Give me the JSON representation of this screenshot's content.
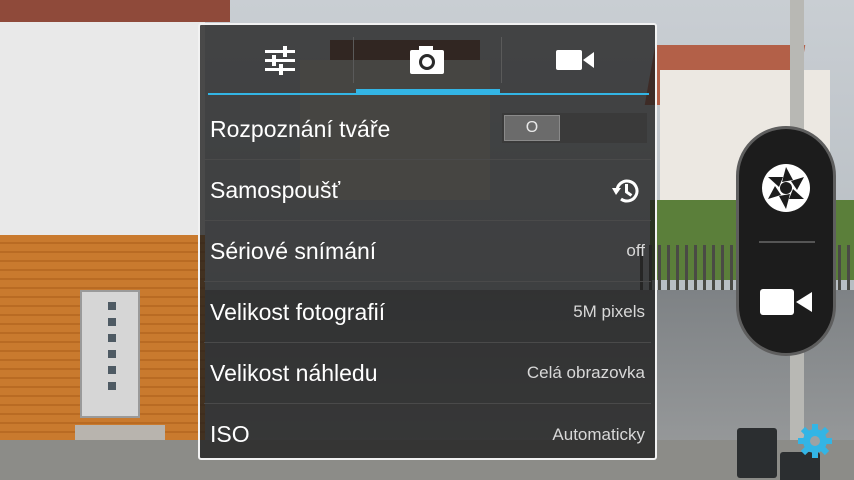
{
  "tabs": [
    {
      "icon": "settings-sliders-icon",
      "active": false
    },
    {
      "icon": "camera-icon",
      "active": true
    },
    {
      "icon": "video-camera-icon",
      "active": false
    }
  ],
  "settings": {
    "face_detection": {
      "label": "Rozpoznání tváře",
      "value": "O"
    },
    "self_timer": {
      "label": "Samospoušť",
      "icon": "timer-icon"
    },
    "burst": {
      "label": "Sériové snímání",
      "value": "off"
    },
    "photo_size": {
      "label": "Velikost fotografií",
      "value": "5M pixels"
    },
    "preview_size": {
      "label": "Velikost náhledu",
      "value": "Celá obrazovka"
    },
    "iso": {
      "label": "ISO",
      "value": "Automaticky"
    }
  },
  "controls": {
    "shutter_icon": "aperture-icon",
    "video_icon": "video-camera-icon",
    "settings_icon": "gear-icon"
  },
  "colors": {
    "accent": "#33b5e5",
    "panel_bg": "rgba(28,28,28,0.78)"
  }
}
